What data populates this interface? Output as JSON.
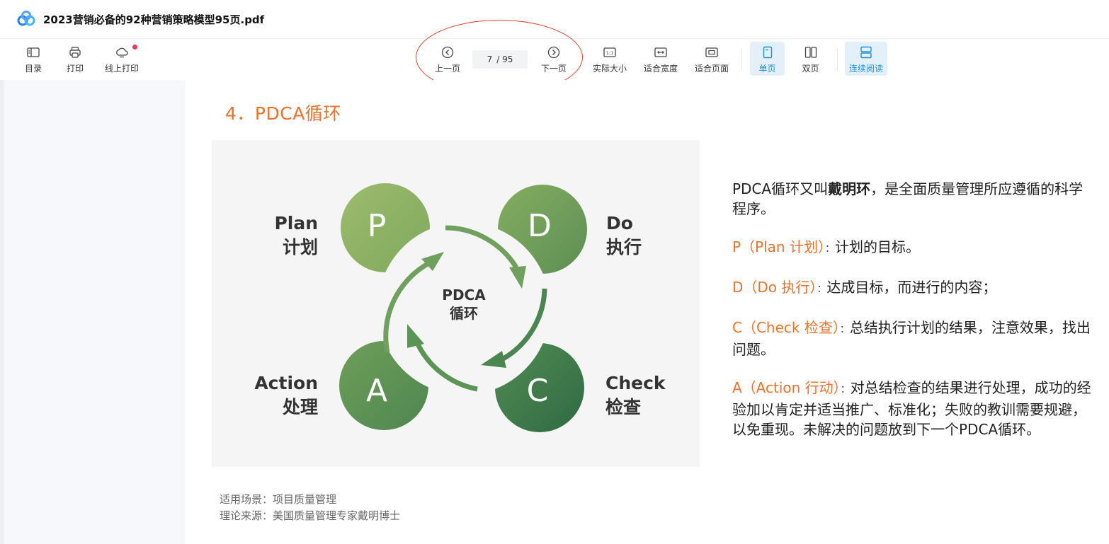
{
  "window": {
    "title": "2023营销必备的92种营销策略模型95页.pdf"
  },
  "toolbar": {
    "toc_label": "目录",
    "print_label": "打印",
    "online_print_label": "线上打印",
    "prev_label": "上一页",
    "page_current": "7",
    "page_total": "/ 95",
    "next_label": "下一页",
    "actual_size_label": "实际大小",
    "fit_width_label": "适合宽度",
    "fit_page_label": "适合页面",
    "single_page_label": "单页",
    "double_page_label": "双页",
    "continuous_label": "连续阅读",
    "actual_size_icon_text": "1:1"
  },
  "page": {
    "heading": "4．PDCA循环",
    "diagram": {
      "center_line1": "PDCA",
      "center_line2": "循环",
      "p_letter": "P",
      "d_letter": "D",
      "a_letter": "A",
      "c_letter": "C",
      "plan_en": "Plan",
      "plan_cn": "计划",
      "do_en": "Do",
      "do_cn": "执行",
      "action_en": "Action",
      "action_cn": "处理",
      "check_en": "Check",
      "check_cn": "检查"
    },
    "desc": {
      "intro_a": "PDCA循环又叫",
      "intro_bold": "戴明环",
      "intro_b": "，是全面质量管理所应遵循的科学程序。",
      "p_label": "P（Plan 计划）",
      "p_text": "计划的目标。",
      "d_label": "D（Do 执行）",
      "d_text": "达成目标，而进行的内容；",
      "c_label": "C（Check 检查）",
      "c_text": "总结执行计划的结果，注意效果，找出问题。",
      "a_label": "A（Action 行动）",
      "a_text": "对总结检查的结果进行处理，成功的经验加以肯定并适当推广、标准化；失败的教训需要规避，以免重现。未解决的问题放到下一个PDCA循环。",
      "colon": "："
    },
    "footer": {
      "scene": "适用场景：项目质量管理",
      "source": "理论来源：美国质量管理专家戴明博士"
    }
  },
  "colors": {
    "accent_orange": "#e9722d",
    "selected_blue": "#1e8fd6",
    "annotation_red": "#e0442e",
    "green_light": "#8fb165",
    "green_dark": "#3f7a4c"
  }
}
